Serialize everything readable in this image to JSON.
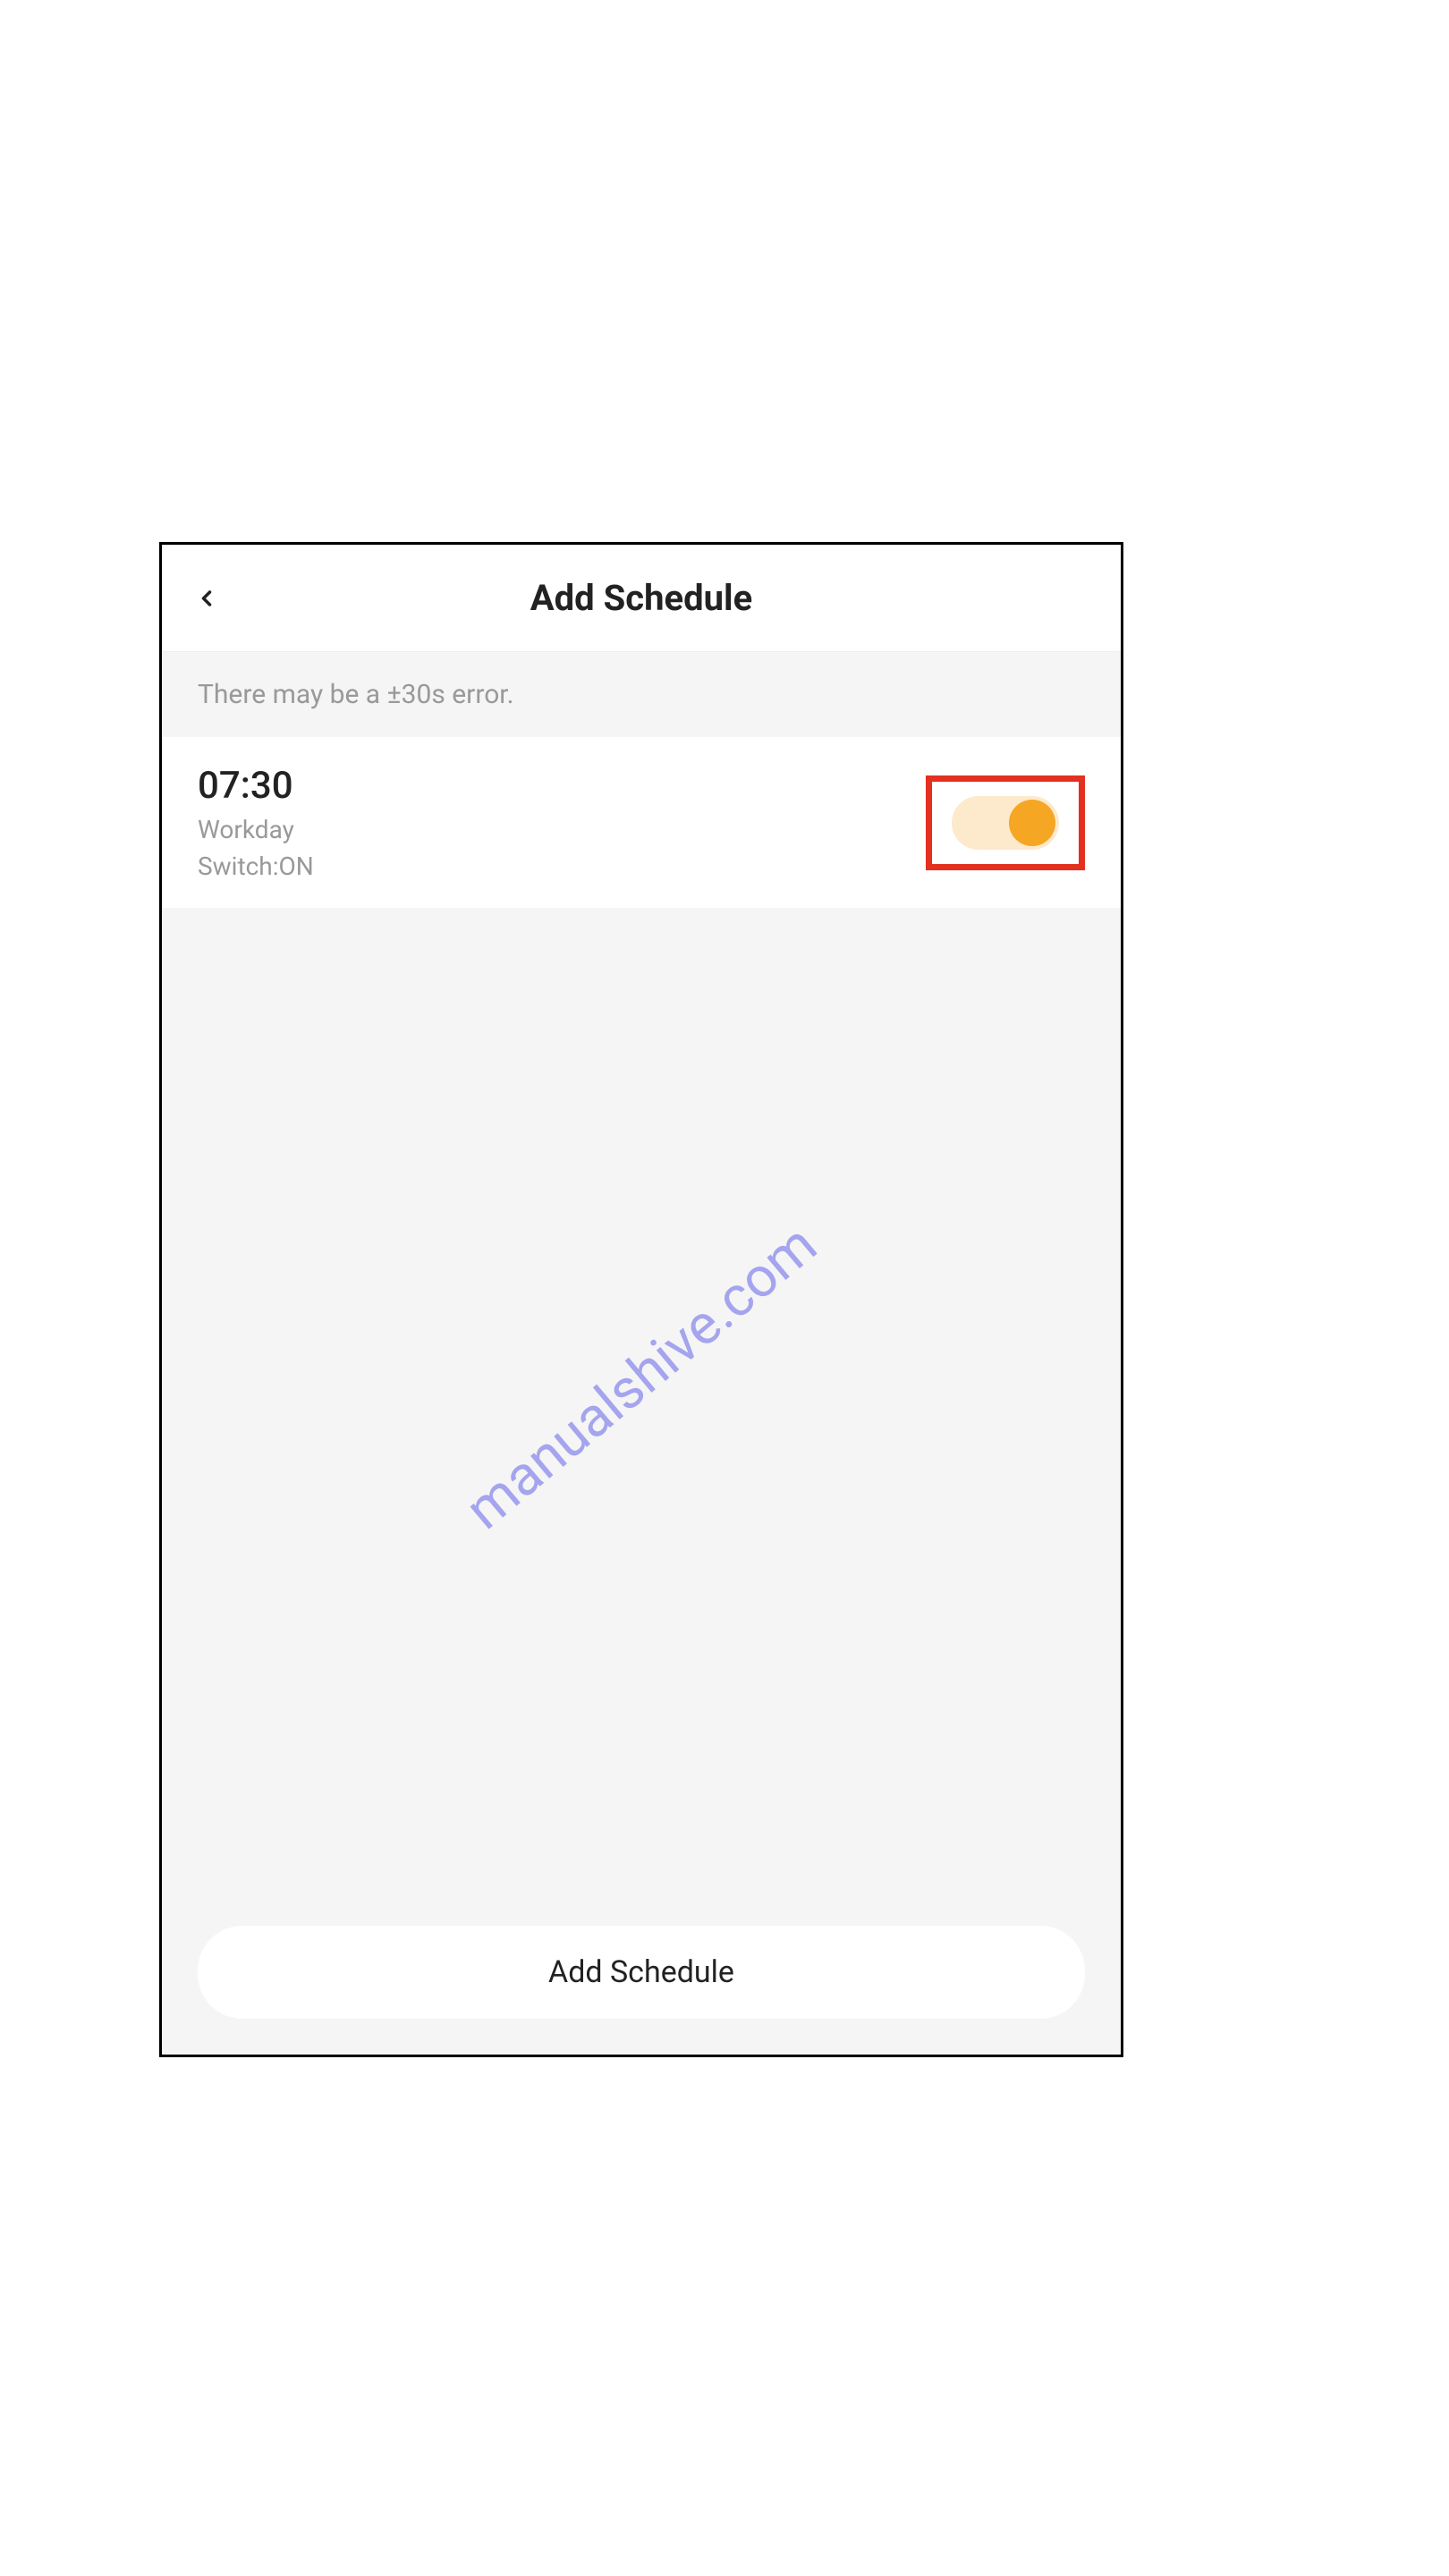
{
  "header": {
    "title": "Add Schedule"
  },
  "info_banner": "There may be a ±30s error.",
  "schedule": {
    "time": "07:30",
    "days": "Workday",
    "switch_label": "Switch:ON",
    "toggle_on": true
  },
  "add_button": "Add Schedule",
  "watermark": "manualshive.com"
}
